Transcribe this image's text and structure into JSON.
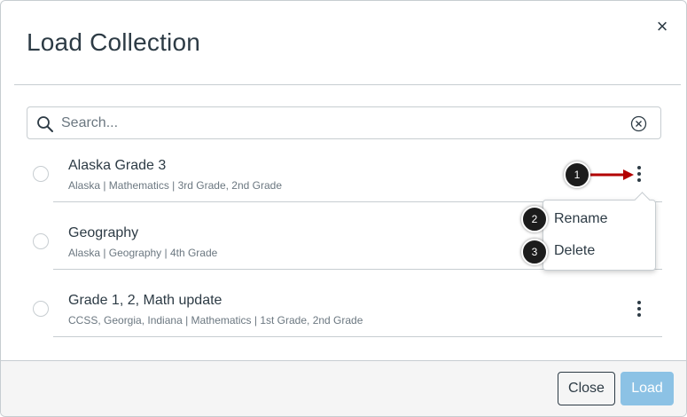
{
  "dialog": {
    "title": "Load Collection",
    "close_symbol": "×"
  },
  "search": {
    "placeholder": "Search...",
    "value": ""
  },
  "collections": [
    {
      "title": "Alaska Grade 3",
      "meta": "Alaska | Mathematics | 3rd Grade, 2nd Grade"
    },
    {
      "title": "Geography",
      "meta": "Alaska | Geography | 4th Grade"
    },
    {
      "title": "Grade 1, 2, Math update",
      "meta": "CCSS, Georgia, Indiana | Mathematics | 1st Grade, 2nd Grade"
    }
  ],
  "options_menu": {
    "items": [
      "Rename",
      "Delete"
    ]
  },
  "callouts": [
    "1",
    "2",
    "3"
  ],
  "footer": {
    "close_label": "Close",
    "load_label": "Load"
  },
  "icons": {
    "search": "search-icon",
    "clear": "clear-circle-icon",
    "kebab": "kebab-menu-icon",
    "close": "close-icon"
  },
  "colors": {
    "text": "#2d3b45",
    "muted": "#6b7780",
    "border": "#c7cdd1",
    "load_button": "#8cc2e5",
    "callout_arrow": "#b30000",
    "footer_bg": "#f5f5f5"
  }
}
